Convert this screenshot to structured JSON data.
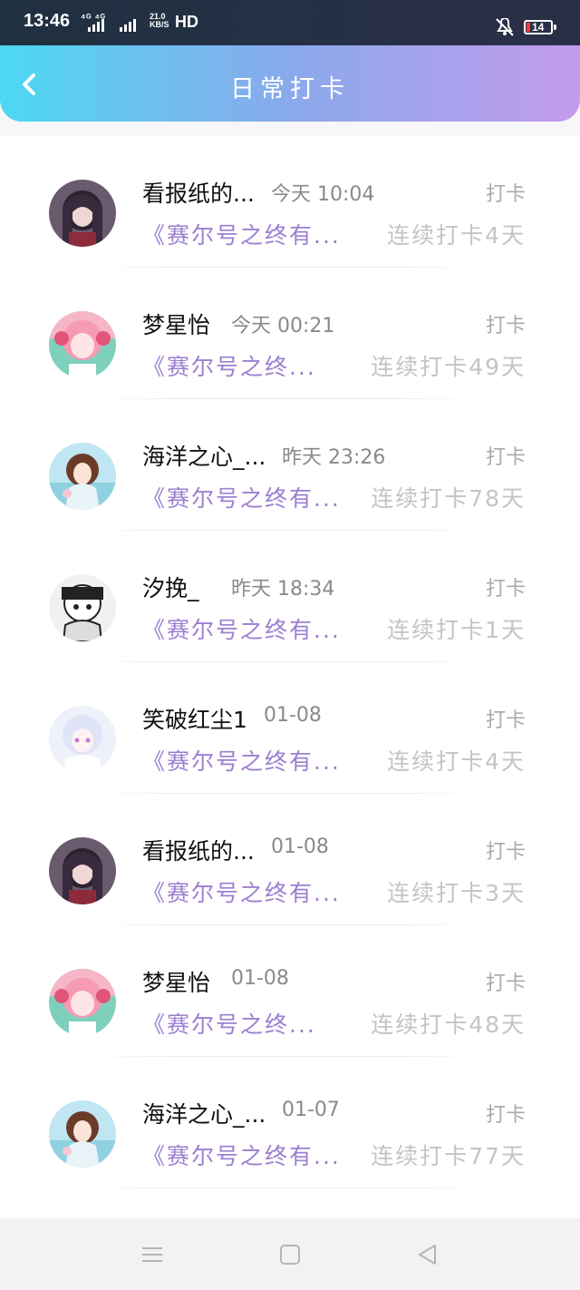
{
  "status": {
    "time": "13:46",
    "network": "⁴ᴳ ⁴ᴳ",
    "speed_value": "21.0",
    "speed_unit": "KB/S",
    "hd": "HD",
    "battery": "14"
  },
  "header": {
    "title": "日常打卡",
    "back_icon": "chevron-left-icon"
  },
  "items": [
    {
      "name": "看报纸的...",
      "time": "今天 10:04",
      "action": "打卡",
      "book": "《赛尔号之终有...",
      "streak": "连续打卡4天",
      "avatar": "dark"
    },
    {
      "name": "梦星怡",
      "time": "今天 00:21",
      "action": "打卡",
      "book": "《赛尔号之终...",
      "streak": "连续打卡49天",
      "avatar": "pink"
    },
    {
      "name": "海洋之心_...",
      "time": "昨天 23:26",
      "action": "打卡",
      "book": "《赛尔号之终有...",
      "streak": "连续打卡78天",
      "avatar": "ocean"
    },
    {
      "name": "汐挽_",
      "time": "昨天 18:34",
      "action": "打卡",
      "book": "《赛尔号之终有...",
      "streak": "连续打卡1天",
      "avatar": "sketch"
    },
    {
      "name": "笑破红尘1",
      "time": "01-08",
      "action": "打卡",
      "book": "《赛尔号之终有...",
      "streak": "连续打卡4天",
      "avatar": "light"
    },
    {
      "name": "看报纸的...",
      "time": "01-08",
      "action": "打卡",
      "book": "《赛尔号之终有...",
      "streak": "连续打卡3天",
      "avatar": "dark"
    },
    {
      "name": "梦星怡",
      "time": "01-08",
      "action": "打卡",
      "book": "《赛尔号之终...",
      "streak": "连续打卡48天",
      "avatar": "pink"
    },
    {
      "name": "海洋之心_...",
      "time": "01-07",
      "action": "打卡",
      "book": "《赛尔号之终有...",
      "streak": "连续打卡77天",
      "avatar": "ocean"
    }
  ],
  "nav": {
    "menu_icon": "menu-icon",
    "home_icon": "square-home-icon",
    "back_icon": "triangle-back-icon"
  },
  "colors": {
    "header_start": "#4dd8f2",
    "header_end": "#c39bec",
    "book_text": "#9c7fd0",
    "streak_text": "#c4c4c4"
  }
}
